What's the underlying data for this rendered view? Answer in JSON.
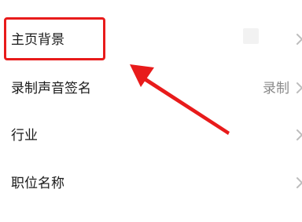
{
  "settings": {
    "items": [
      {
        "label": "主页背景",
        "value": ""
      },
      {
        "label": "录制声音签名",
        "value": "录制"
      },
      {
        "label": "行业",
        "value": ""
      },
      {
        "label": "职位名称",
        "value": ""
      }
    ]
  },
  "annotation": {
    "color": "#e81b1b",
    "target": "主页背景"
  }
}
